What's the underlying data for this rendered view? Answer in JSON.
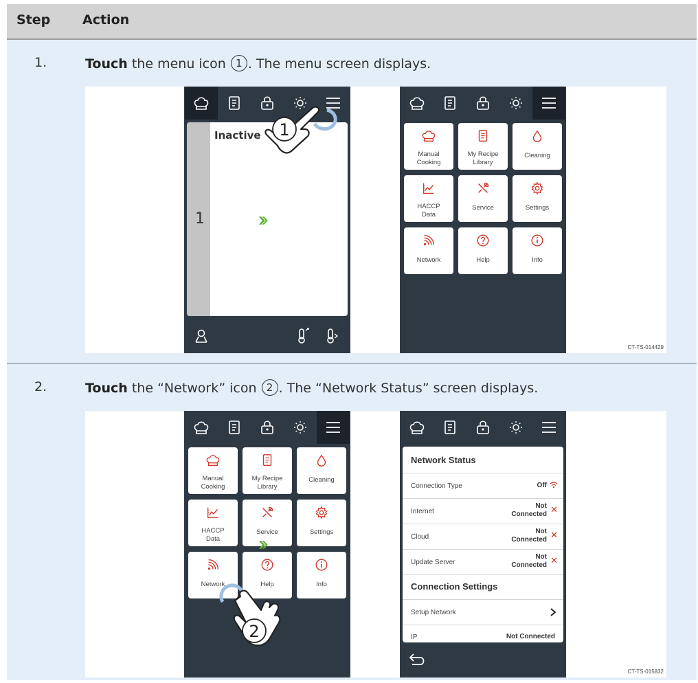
{
  "header": {
    "step": "Step",
    "action": "Action"
  },
  "rows": [
    {
      "num": "1.",
      "bold": "Touch",
      "text_pre": " the menu icon ",
      "callout": "1",
      "text_post": ". The menu screen displays.",
      "figure_code": "CT-TS-014429"
    },
    {
      "num": "2.",
      "bold": "Touch",
      "text_pre": " the “Network” icon ",
      "callout": "2",
      "text_post": ". The “Network Status” screen displays.",
      "figure_code": "CT-TS-015832"
    }
  ],
  "home_screen": {
    "status": "Inactive",
    "chamber": "1"
  },
  "menu": {
    "tiles": [
      {
        "label": "Manual Cooking",
        "icon": "chef-hat-icon"
      },
      {
        "label": "My Recipe Library",
        "icon": "recipe-book-icon"
      },
      {
        "label": "Cleaning",
        "icon": "water-drop-icon"
      },
      {
        "label": "HACCP Data",
        "icon": "chart-icon"
      },
      {
        "label": "Service",
        "icon": "tools-icon"
      },
      {
        "label": "Settings",
        "icon": "gear-icon"
      },
      {
        "label": "Network",
        "icon": "wifi-icon"
      },
      {
        "label": "Help",
        "icon": "help-icon"
      },
      {
        "label": "Info",
        "icon": "info-icon"
      }
    ]
  },
  "network_status": {
    "title": "Network Status",
    "rows": [
      {
        "label": "Connection Type",
        "value": "Off"
      },
      {
        "label": "Internet",
        "value1": "Not",
        "value2": "Connected"
      },
      {
        "label": "Cloud",
        "value1": "Not",
        "value2": "Connected"
      },
      {
        "label": "Update Server",
        "value1": "Not",
        "value2": "Connected"
      }
    ],
    "settings_title": "Connection Settings",
    "setup_label": "Setup Network",
    "ip_label": "IP",
    "ip_value": "Not Connected"
  },
  "colors": {
    "accent": "#d0372b",
    "screen": "#2f3944",
    "arrow": "#5bb233",
    "row_bg": "#e3eef9"
  }
}
